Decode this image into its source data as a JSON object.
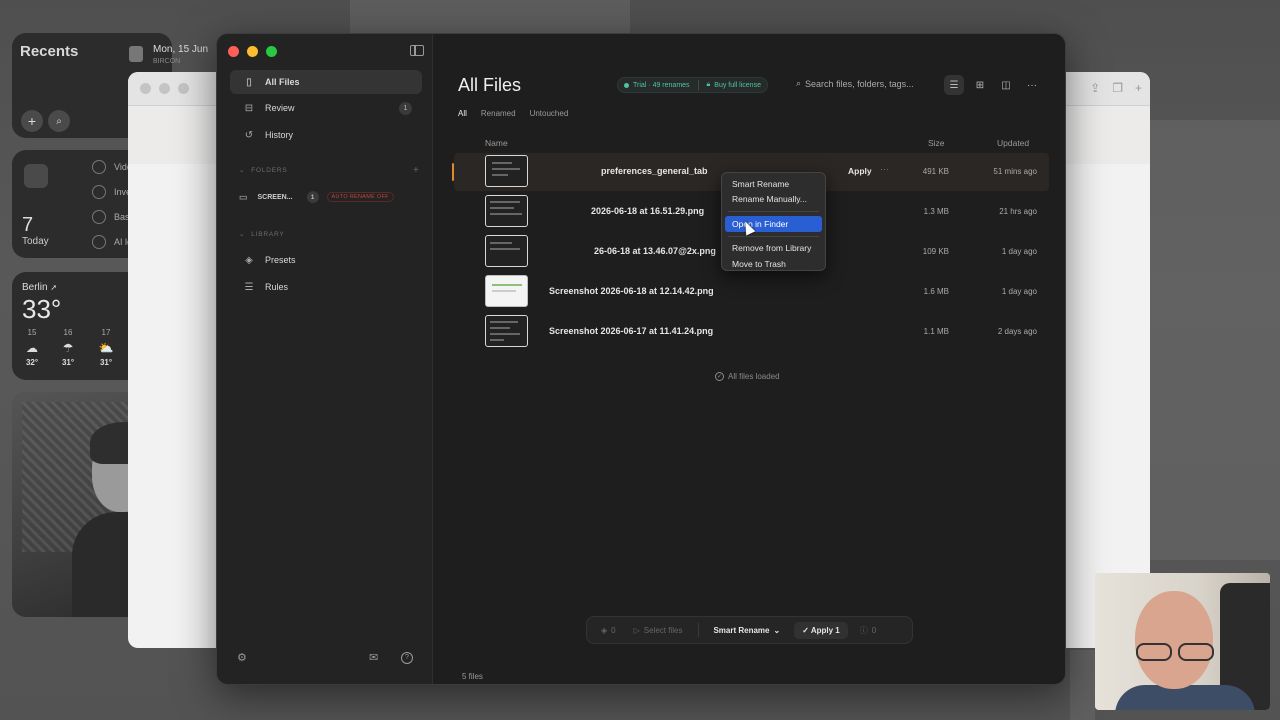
{
  "widgets": {
    "recents_title": "Recents",
    "calendar_date": "Mon, 15 Jun",
    "calendar_sub": "BIRCON",
    "tasks_count": "7",
    "tasks_today": "Today",
    "tasks": [
      "Vide",
      "Inve",
      "Bas",
      "AI lo"
    ],
    "weather_city": "Berlin",
    "weather_temp": "33°",
    "forecast": [
      {
        "day": "15",
        "temp": "32°"
      },
      {
        "day": "16",
        "temp": "31°"
      },
      {
        "day": "17",
        "temp": "31°"
      }
    ]
  },
  "sidebar": {
    "nav": [
      {
        "label": "All Files",
        "icon": "document-icon"
      },
      {
        "label": "Review",
        "badge": "1",
        "icon": "inbox-icon"
      },
      {
        "label": "History",
        "icon": "history-icon"
      }
    ],
    "folders_label": "FOLDERS",
    "folder": {
      "name": "SCREEN...",
      "badge": "1",
      "tag": "AUTO RENAME OFF"
    },
    "library_label": "LIBRARY",
    "library": [
      {
        "label": "Presets",
        "icon": "layers-icon"
      },
      {
        "label": "Rules",
        "icon": "sliders-icon"
      }
    ]
  },
  "main": {
    "title": "All Files",
    "trial": "Trial · 49 renames",
    "buy": "Buy full license",
    "search_placeholder": "Search files, folders, tags...",
    "tabs": [
      "All",
      "Renamed",
      "Untouched"
    ],
    "columns": {
      "name": "Name",
      "size": "Size",
      "updated": "Updated"
    },
    "files": [
      {
        "name": "preferences_general_tab",
        "size": "491 KB",
        "updated": "51 mins ago",
        "action": "Apply",
        "more": "···"
      },
      {
        "name": "2026-06-18 at 16.51.29.png",
        "size": "1.3 MB",
        "updated": "21 hrs ago"
      },
      {
        "name": "26-06-18 at 13.46.07@2x.png",
        "size": "109 KB",
        "updated": "1 day ago"
      },
      {
        "name": "Screenshot 2026-06-18 at 12.14.42.png",
        "size": "1.6 MB",
        "updated": "1 day ago"
      },
      {
        "name": "Screenshot 2026-06-17 at 11.41.24.png",
        "size": "1.1 MB",
        "updated": "2 days ago"
      }
    ],
    "loaded": "All files loaded",
    "context_menu": [
      "Smart Rename",
      "Rename Manually...",
      "Open in Finder",
      "Remove from Library",
      "Move to Trash"
    ],
    "context_highlight": "Open in Finder",
    "actionbar": {
      "count_left": "0",
      "select": "Select files",
      "mode": "Smart Rename",
      "apply": "Apply 1",
      "count_right": "0"
    },
    "footer": "5 files"
  },
  "colors": {
    "accent": "#4fc3a7",
    "highlight": "#2a5fd4",
    "marker": "#e08a2d"
  }
}
